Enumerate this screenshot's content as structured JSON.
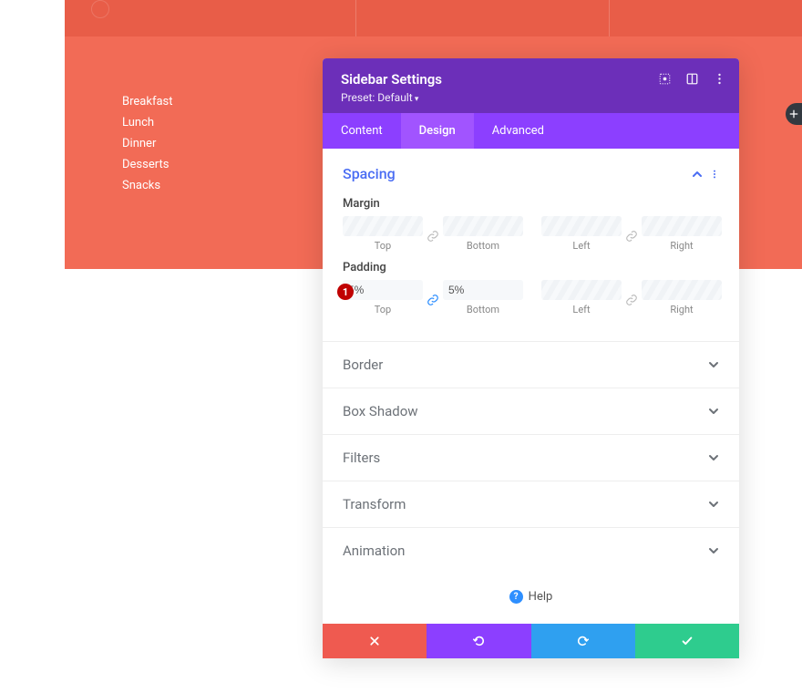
{
  "sidebar_menu": [
    "Breakfast",
    "Lunch",
    "Dinner",
    "Desserts",
    "Snacks"
  ],
  "modal": {
    "title": "Sidebar Settings",
    "preset_label": "Preset: Default",
    "tabs": {
      "content": "Content",
      "design": "Design",
      "advanced": "Advanced",
      "active": "design"
    },
    "spacing": {
      "title": "Spacing",
      "margin_label": "Margin",
      "padding_label": "Padding",
      "captions": {
        "top": "Top",
        "bottom": "Bottom",
        "left": "Left",
        "right": "Right"
      },
      "margin": {
        "top": "",
        "bottom": "",
        "left": "",
        "right": ""
      },
      "padding": {
        "top": "5%",
        "bottom": "5%",
        "left": "",
        "right": ""
      }
    },
    "accordions": [
      "Border",
      "Box Shadow",
      "Filters",
      "Transform",
      "Animation"
    ],
    "help_label": "Help",
    "annotation": "1"
  }
}
